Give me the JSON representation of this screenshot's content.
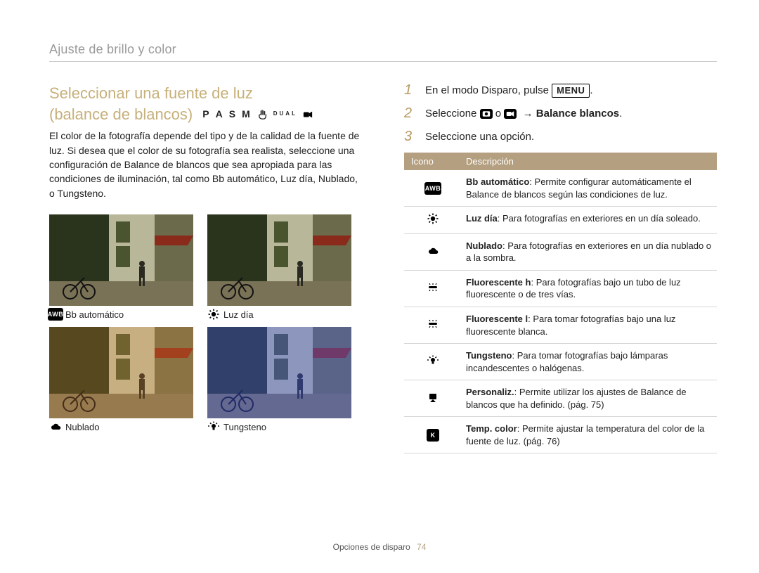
{
  "section_header": "Ajuste de brillo y color",
  "title_line1": "Seleccionar una fuente de luz",
  "title_line2": "(balance de blancos)",
  "mode_letters": [
    "P",
    "A",
    "S",
    "M"
  ],
  "mode_dual": "DUAL",
  "body_paragraph": "El color de la fotografía depende del tipo y de la calidad de la fuente de luz. Si desea que el color de su fotografía sea realista, seleccione una configuración de Balance de blancos que sea apropiada para las condiciones de iluminación, tal como Bb automático, Luz día, Nublado, o Tungsteno.",
  "thumbs": [
    {
      "icon": "awb-badge",
      "label": "Bb automático",
      "tint": ""
    },
    {
      "icon": "sun",
      "label": "Luz día",
      "tint": ""
    },
    {
      "icon": "cloud",
      "label": "Nublado",
      "tint": "warm"
    },
    {
      "icon": "bulb",
      "label": "Tungsteno",
      "tint": "cool"
    }
  ],
  "steps": [
    {
      "pre": "En el modo Disparo, pulse ",
      "pill": "MENU",
      "post": "."
    },
    {
      "pre": "Seleccione ",
      "icon1": "camera-badge",
      "mid": " o ",
      "icon2": "video-badge",
      "post_bold": "Balance blancos",
      "tail": "."
    },
    {
      "pre": "Seleccione una opción."
    }
  ],
  "table": {
    "head_icon": "Icono",
    "head_desc": "Descripción",
    "rows": [
      {
        "icon": "awb-badge",
        "bold": "Bb automático",
        "text": ": Permite configurar automáticamente el Balance de blancos según las condiciones de luz."
      },
      {
        "icon": "sun",
        "bold": "Luz día",
        "text": ": Para fotografías en exteriores en un día soleado."
      },
      {
        "icon": "cloud",
        "bold": "Nublado",
        "text": ": Para fotografías en exteriores en un día nublado o a la sombra."
      },
      {
        "icon": "fluor-h",
        "bold": "Fluorescente h",
        "text": ": Para fotografías bajo un tubo de luz fluorescente o de tres vías."
      },
      {
        "icon": "fluor-l",
        "bold": "Fluorescente l",
        "text": ": Para tomar fotografías bajo una luz fluorescente blanca."
      },
      {
        "icon": "bulb",
        "bold": "Tungsteno",
        "text": ": Para tomar fotografías bajo lámparas incandescentes o halógenas."
      },
      {
        "icon": "custom",
        "bold": "Personaliz.",
        "text": ": Permite utilizar los ajustes de Balance de blancos que ha definido. (pág. 75)"
      },
      {
        "icon": "k-badge",
        "bold": "Temp. color",
        "text": ": Permite ajustar la temperatura del color de la fuente de luz. (pág. 76)"
      }
    ]
  },
  "footer_text": "Opciones de disparo",
  "footer_page": "74"
}
